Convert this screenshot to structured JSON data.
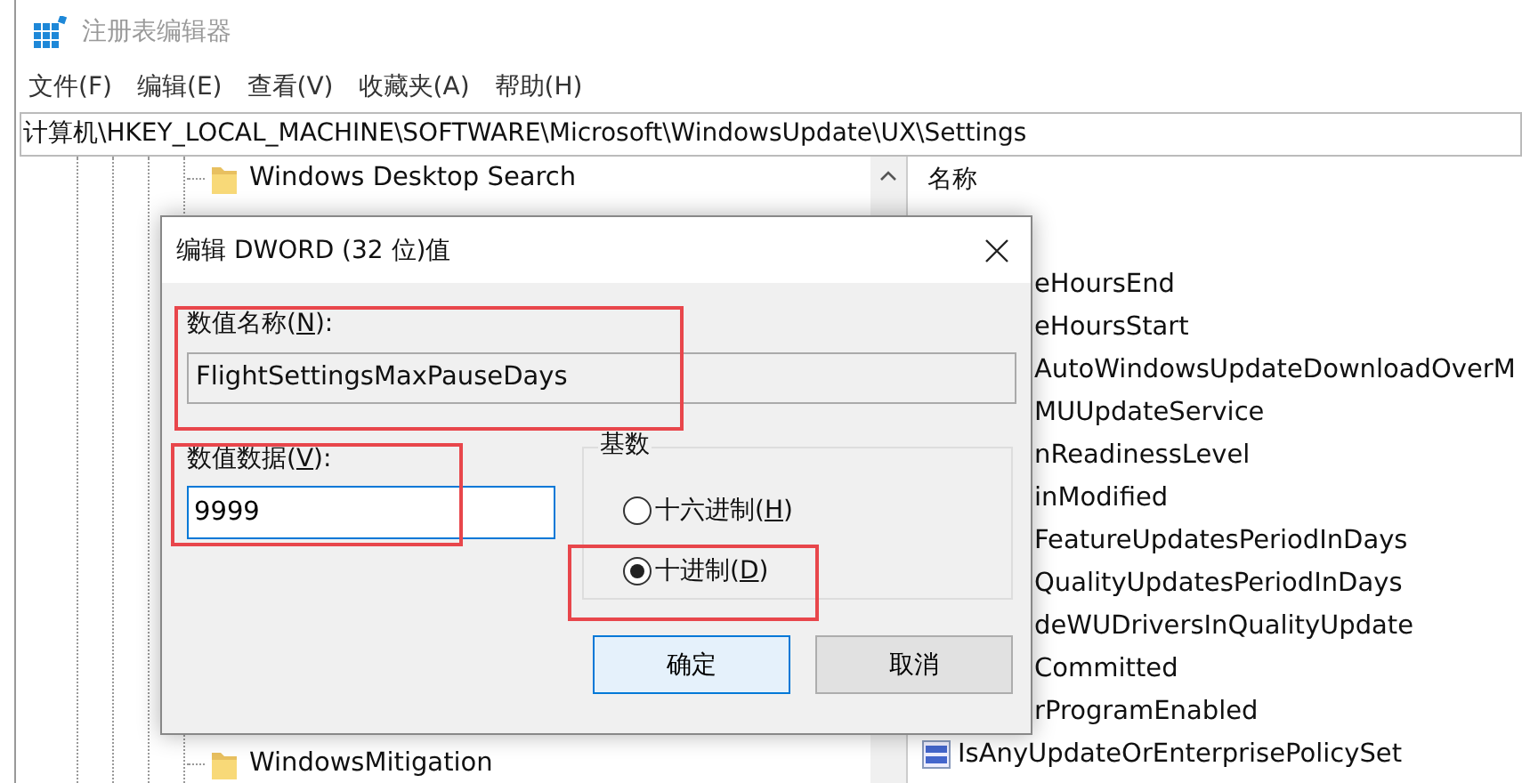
{
  "window": {
    "title": "注册表编辑器"
  },
  "menu": [
    "文件(F)",
    "编辑(E)",
    "查看(V)",
    "收藏夹(A)",
    "帮助(H)"
  ],
  "address": "计算机\\HKEY_LOCAL_MACHINE\\SOFTWARE\\Microsoft\\WindowsUpdate\\UX\\Settings",
  "tree": {
    "top_items": [
      "Windows Desktop Search"
    ],
    "bottom_items": [
      "WindowsMitigation"
    ]
  },
  "values": {
    "column": "名称",
    "rows": [
      {
        "kind": "covered",
        "name": "eHoursEnd"
      },
      {
        "kind": "covered",
        "name": "eHoursStart"
      },
      {
        "kind": "covered",
        "name": "AutoWindowsUpdateDownloadOverM"
      },
      {
        "kind": "covered",
        "name": "MUUpdateService"
      },
      {
        "kind": "covered",
        "name": "nReadinessLevel"
      },
      {
        "kind": "covered",
        "name": "inModified"
      },
      {
        "kind": "covered",
        "name": "FeatureUpdatesPeriodInDays"
      },
      {
        "kind": "covered",
        "name": "QualityUpdatesPeriodInDays"
      },
      {
        "kind": "covered",
        "name": "deWUDriversInQualityUpdate"
      },
      {
        "kind": "covered",
        "name": "Committed"
      },
      {
        "kind": "covered",
        "name": "rProgramEnabled"
      },
      {
        "kind": "entry",
        "name": "IsAnyUpdateOrEnterprisePolicySet"
      }
    ]
  },
  "dialog": {
    "title": "编辑 DWORD (32 位)值",
    "name_label": {
      "before": "数值名称(",
      "key": "N",
      "after": "):"
    },
    "name_value": "FlightSettingsMaxPauseDays",
    "name_highlighted": true,
    "data_label": {
      "before": "数值数据(",
      "key": "V",
      "after": "):"
    },
    "data_value": "9999",
    "data_highlighted": true,
    "base_title": "基数",
    "bases": [
      {
        "before": "十六进制(",
        "key": "H",
        "after": ")",
        "selected": false,
        "highlighted": false
      },
      {
        "before": "十进制(",
        "key": "D",
        "after": ")",
        "selected": true,
        "highlighted": true
      }
    ],
    "buttons": [
      {
        "label": "确定",
        "kind": "default"
      },
      {
        "label": "取消",
        "kind": "normal"
      }
    ]
  }
}
